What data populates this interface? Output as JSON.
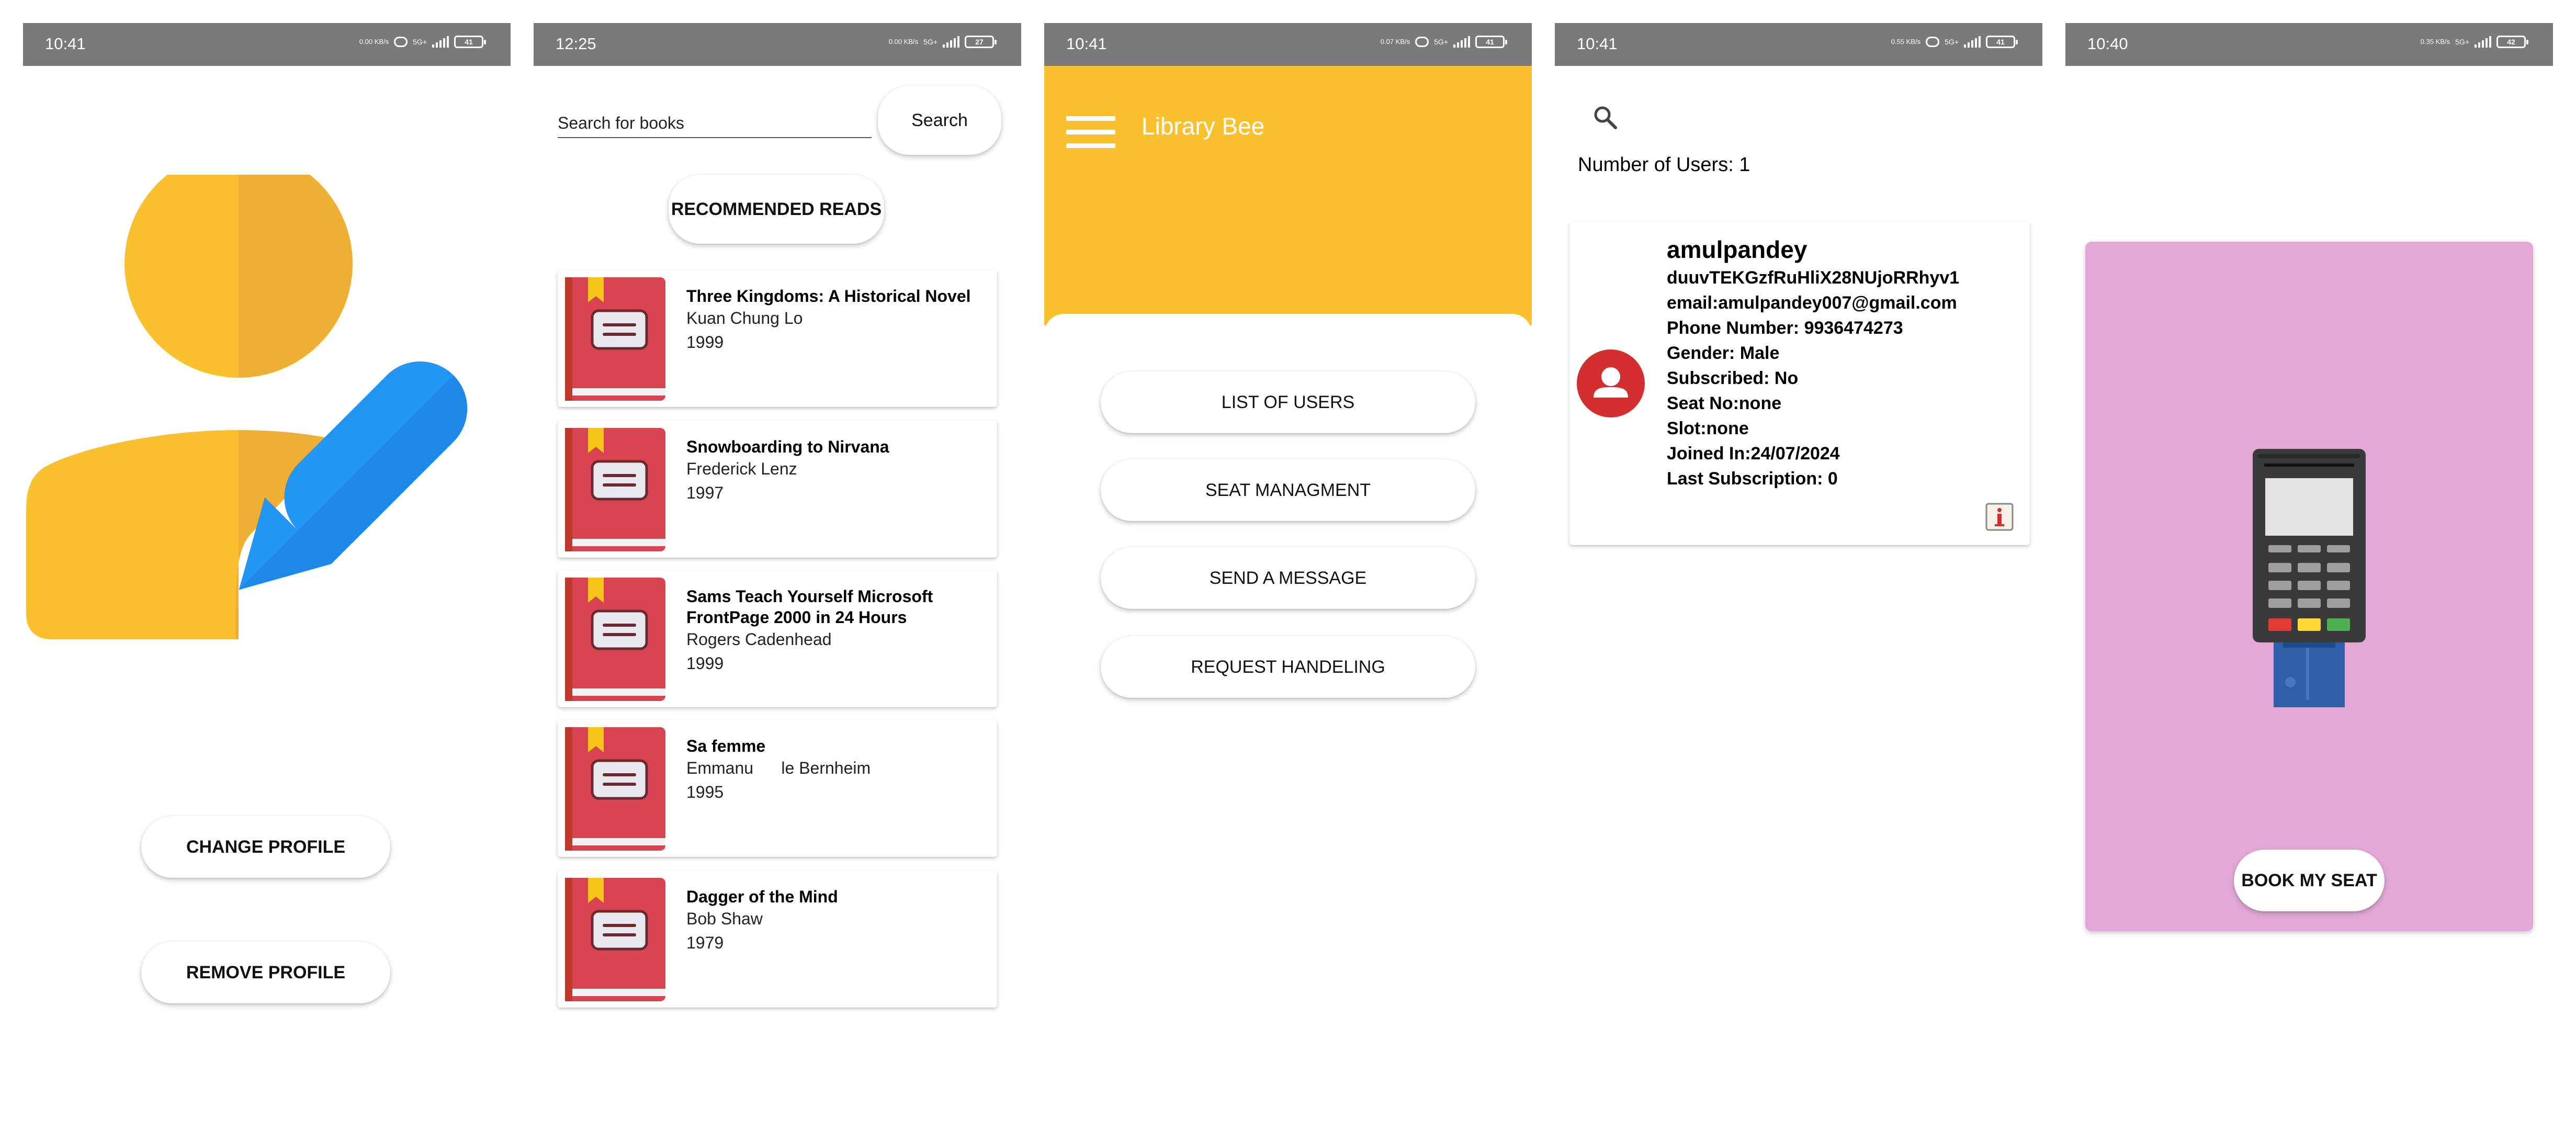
{
  "status_bars": [
    {
      "time": "10:41",
      "speed": "0.00 KB/s",
      "net": "5G+",
      "battery": "41"
    },
    {
      "time": "12:25",
      "speed": "0.00 KB/s",
      "net": "5G+",
      "battery": "27"
    },
    {
      "time": "10:41",
      "speed": "0.07 KB/s",
      "net": "5G+",
      "battery": "41"
    },
    {
      "time": "10:41",
      "speed": "0.55 KB/s",
      "net": "5G+",
      "battery": "41"
    },
    {
      "time": "10:40",
      "speed": "0.35 KB/s",
      "net": "5G+",
      "battery": "42"
    }
  ],
  "profile_screen": {
    "change_label": "CHANGE PROFILE",
    "remove_label": "REMOVE PROFILE",
    "illustration": "user-edit-icon",
    "colors": {
      "yellow": "#FBC02D",
      "yellow_shade": "#EDAF34",
      "blue": "#2196F3",
      "blue_shade": "#1E88E5"
    }
  },
  "books_screen": {
    "search_placeholder": "Search for books",
    "search_button": "Search",
    "recommended_label": "RECOMMENDED READS",
    "books": [
      {
        "title": "Three Kingdoms: A Historical Novel",
        "author": "Kuan Chung Lo",
        "year": "1999"
      },
      {
        "title": "Snowboarding to Nirvana",
        "author": "Frederick Lenz",
        "year": "1997"
      },
      {
        "title": "Sams Teach Yourself Microsoft FrontPage 2000 in 24 Hours",
        "author": "Rogers Cadenhead",
        "year": "1999"
      },
      {
        "title": "Sa femme",
        "author": "Emmanu      le Bernheim",
        "year": "1995"
      },
      {
        "title": "Dagger of the Mind",
        "author": "Bob Shaw",
        "year": "1979"
      }
    ],
    "colors": {
      "book_red": "#D94452",
      "book_spine": "#C0392B",
      "bookmark": "#F5C518"
    }
  },
  "admin_screen": {
    "app_title": "Library Bee",
    "menu": [
      "LIST OF USERS",
      "SEAT MANAGMENT",
      "SEND A MESSAGE",
      "REQUEST HANDELING"
    ],
    "accent": "#FBC02D"
  },
  "users_screen": {
    "count_text": "Number of Users: 1",
    "user": {
      "name": "amulpandey",
      "id": "duuvTEKGzfRuHliX28NUjoRRhyv1",
      "email": "email:amulpandey007@gmail.com",
      "phone": "Phone Number: 9936474273",
      "gender": "Gender: Male",
      "subscribed": "Subscribed: No",
      "seat": "Seat No:none",
      "slot": "Slot:none",
      "joined": "Joined In:24/07/2024",
      "last_sub": "Last Subscription: 0"
    },
    "avatar_color": "#D32F2F"
  },
  "seat_screen": {
    "book_label": "BOOK MY SEAT",
    "card_color": "#E4A8D8"
  }
}
